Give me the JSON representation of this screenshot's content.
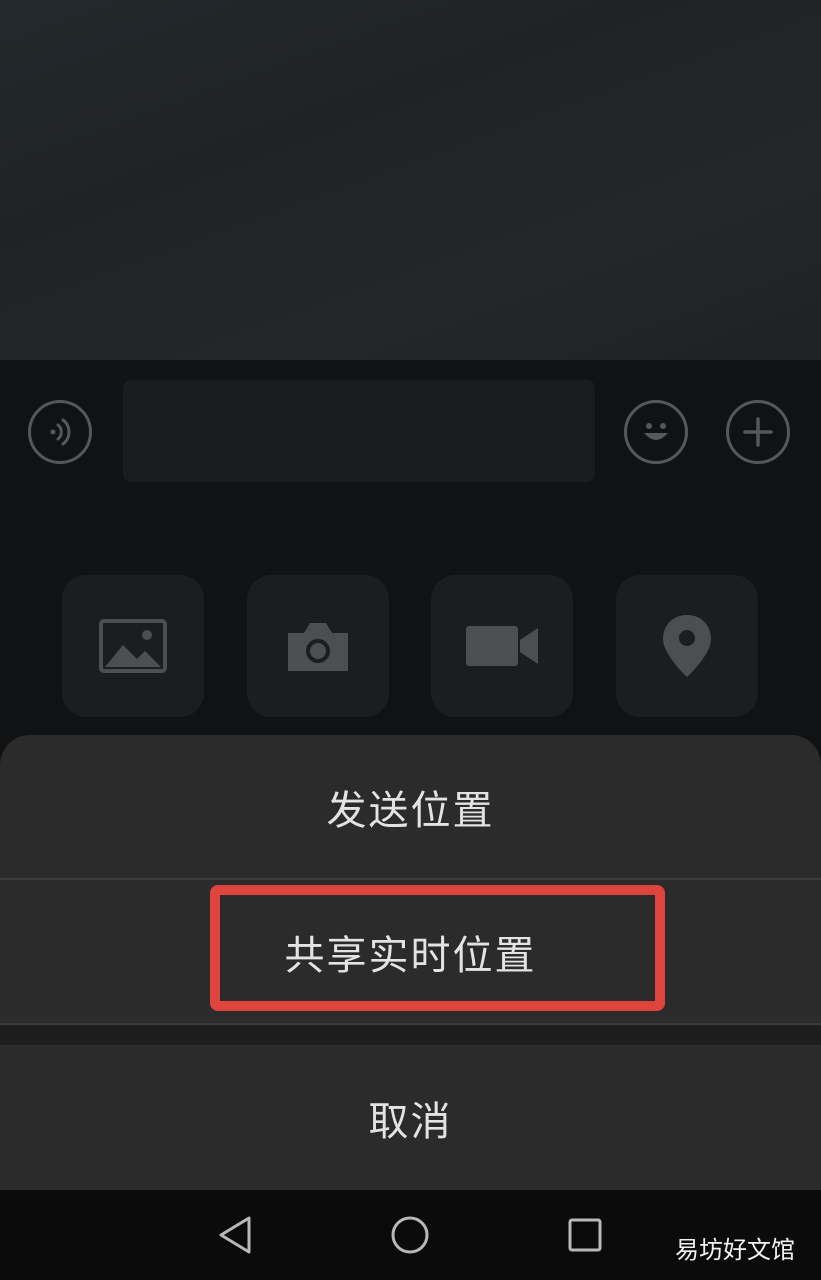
{
  "input_bar": {
    "voice_icon": "voice-wave-icon",
    "emoji_icon": "smiley-icon",
    "plus_icon": "plus-icon",
    "text_value": ""
  },
  "attachments": [
    {
      "icon": "image-icon"
    },
    {
      "icon": "camera-icon"
    },
    {
      "icon": "video-icon"
    },
    {
      "icon": "location-pin-icon"
    }
  ],
  "action_sheet": {
    "send_location": "发送位置",
    "share_live_location": "共享实时位置",
    "cancel": "取消",
    "highlight_color": "#e0443e"
  },
  "nav_bar": {
    "back_icon": "back-triangle-icon",
    "home_icon": "home-circle-icon",
    "recent_icon": "recent-square-icon"
  },
  "watermark": "易坊好文馆"
}
